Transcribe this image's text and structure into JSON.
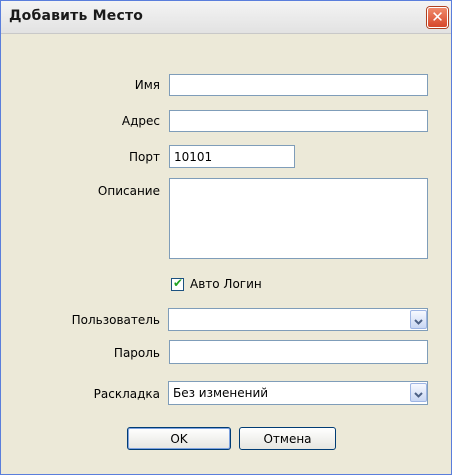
{
  "window": {
    "title": "Добавить Место",
    "close_symbol": "✕"
  },
  "form": {
    "name": {
      "label": "Имя",
      "value": ""
    },
    "address": {
      "label": "Адрес",
      "value": ""
    },
    "port": {
      "label": "Порт",
      "value": "10101"
    },
    "description": {
      "label": "Описание",
      "value": ""
    },
    "auto_login": {
      "label": "Авто Логин",
      "checked": true
    },
    "user": {
      "label": "Пользователь",
      "value": ""
    },
    "password": {
      "label": "Пароль",
      "value": ""
    },
    "layout": {
      "label": "Раскладка",
      "value": "Без изменений"
    }
  },
  "buttons": {
    "ok": "OK",
    "cancel": "Отмена"
  },
  "colors": {
    "border": "#7f9db9",
    "background": "#ece9d8",
    "check": "#21a121"
  }
}
